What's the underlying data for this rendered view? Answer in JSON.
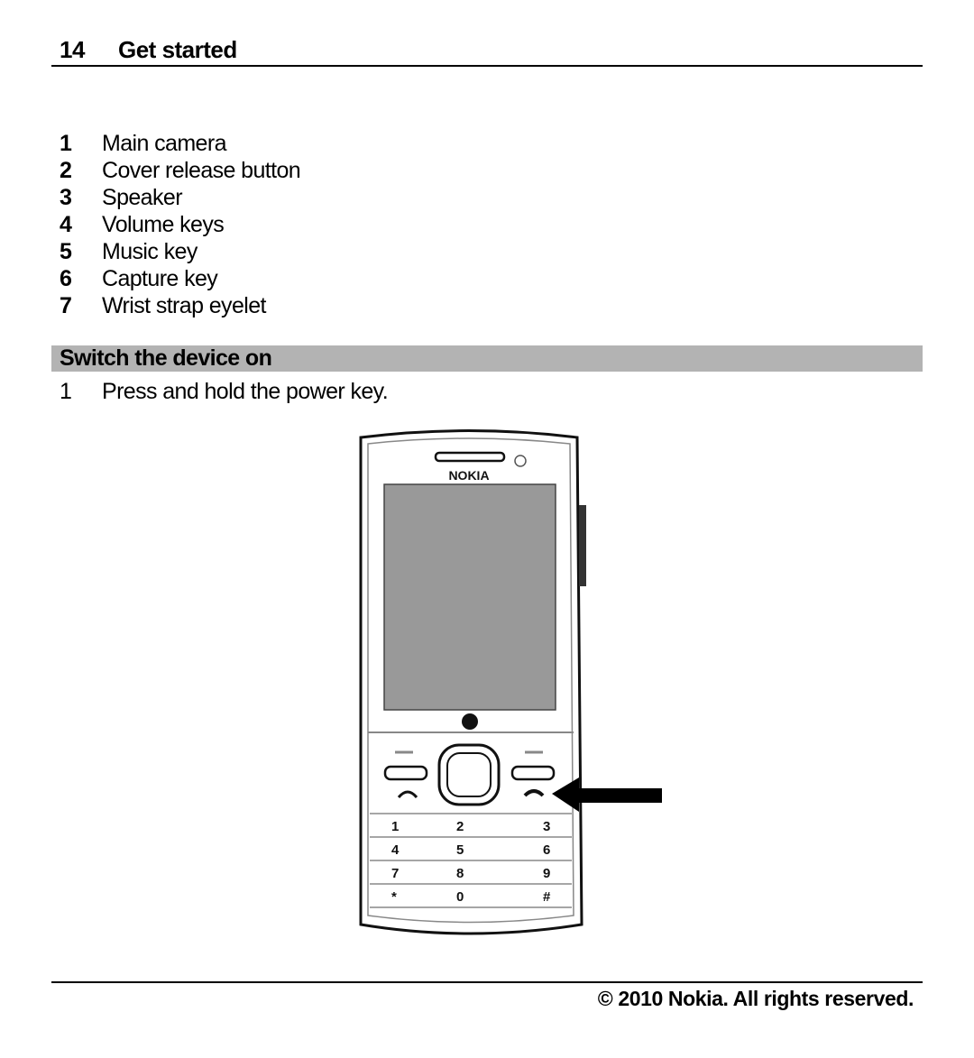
{
  "header": {
    "page_number": "14",
    "title": "Get started"
  },
  "legend": [
    {
      "num": "1",
      "label": "Main camera"
    },
    {
      "num": "2",
      "label": "Cover release button"
    },
    {
      "num": "3",
      "label": "Speaker"
    },
    {
      "num": "4",
      "label": "Volume keys"
    },
    {
      "num": "5",
      "label": "Music key"
    },
    {
      "num": "6",
      "label": "Capture key"
    },
    {
      "num": "7",
      "label": "Wrist strap eyelet"
    }
  ],
  "section": {
    "title": "Switch the device on"
  },
  "steps": [
    {
      "num": "1",
      "text": "Press and hold the power key."
    }
  ],
  "illustration": {
    "brand": "NOKIA",
    "keypad_labels": [
      "1",
      "2",
      "3",
      "4",
      "5",
      "6",
      "7",
      "8",
      "9",
      "*",
      "0",
      "#"
    ]
  },
  "footer": {
    "copyright": "© 2010 Nokia. All rights reserved."
  }
}
